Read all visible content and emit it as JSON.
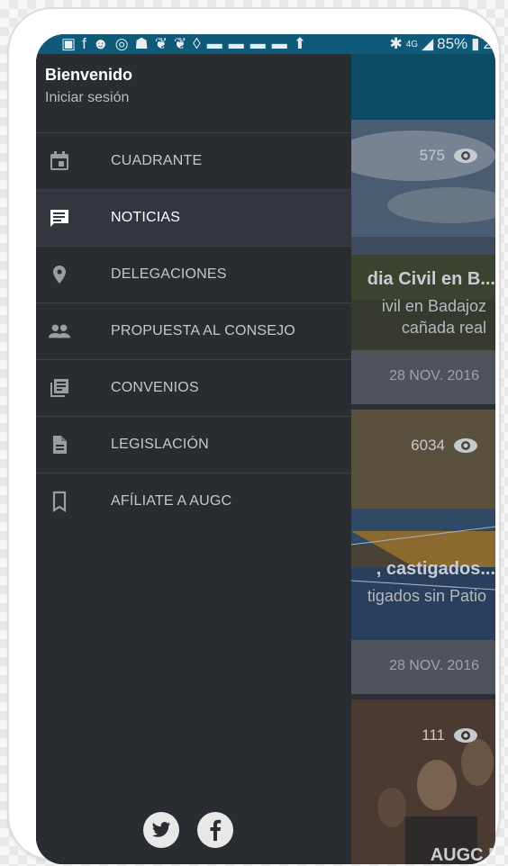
{
  "status_bar": {
    "icons": [
      "gallery-icon",
      "facebook-icon",
      "alien-icon",
      "whatsapp-icon",
      "android-icon",
      "twitter-icon",
      "twitter-icon",
      "shield-icon",
      "notification-icon",
      "notification-icon",
      "notification-icon",
      "notification-icon",
      "upload-icon",
      "bluetooth-icon",
      "signal-4g-icon",
      "battery-icon"
    ],
    "network": "4G",
    "battery": "85%",
    "time_fragment": "2"
  },
  "drawer": {
    "welcome": "Bienvenido",
    "login": "Iniciar sesión",
    "items": [
      {
        "label": "CUADRANTE",
        "icon": "calendar-icon",
        "active": false
      },
      {
        "label": "NOTICIAS",
        "icon": "message-icon",
        "active": true
      },
      {
        "label": "DELEGACIONES",
        "icon": "location-pin-icon",
        "active": false
      },
      {
        "label": "PROPUESTA AL CONSEJO",
        "icon": "people-icon",
        "active": false
      },
      {
        "label": "CONVENIOS",
        "icon": "library-books-icon",
        "active": false
      },
      {
        "label": "LEGISLACIÓN",
        "icon": "document-icon",
        "active": false
      },
      {
        "label": "AFÍLIATE A AUGC",
        "icon": "bookmark-icon",
        "active": false
      }
    ],
    "social": [
      "twitter-icon",
      "facebook-icon"
    ]
  },
  "feed": {
    "cards": [
      {
        "views": "575",
        "title": "dia Civil en B...",
        "subtitle_line1": "ivil en Badajoz",
        "subtitle_line2": "cañada real",
        "date": "28 NOV. 2016"
      },
      {
        "views": "6034",
        "title": ", castigados...",
        "subtitle_line1": "tigados sin Patio",
        "subtitle_line2": "",
        "date": "28 NOV. 2016"
      },
      {
        "views": "111",
        "title": "AUGC Nava",
        "subtitle_line1": "",
        "subtitle_line2": "",
        "date": ""
      }
    ]
  },
  "colors": {
    "drawer_bg": "#292c31",
    "active_item_bg": "#33373d",
    "status_bar": "#0f5a78",
    "app_bar": "#0d4a63"
  }
}
